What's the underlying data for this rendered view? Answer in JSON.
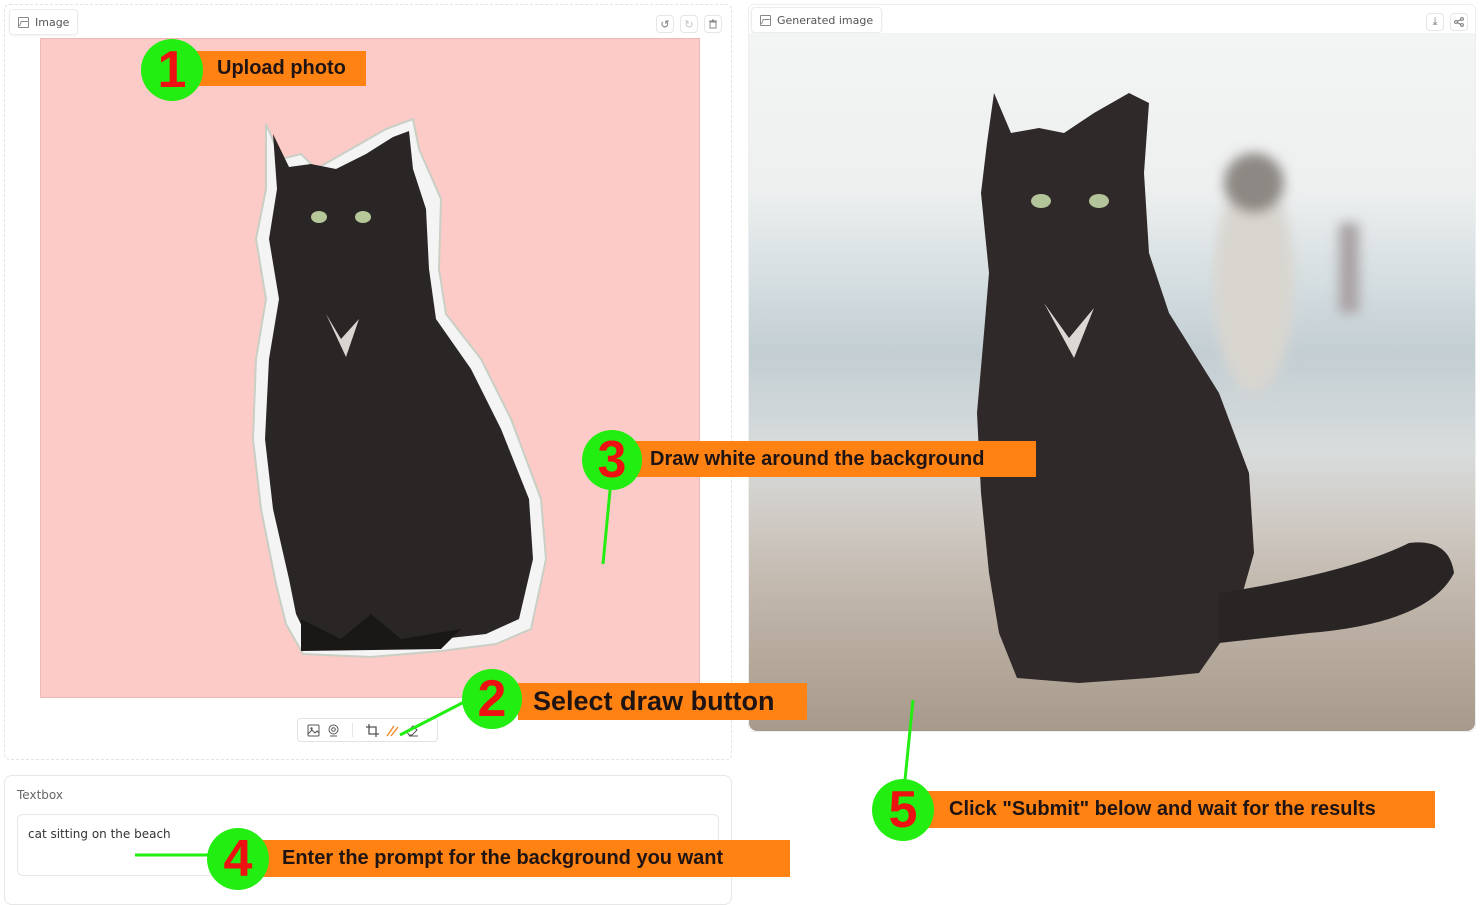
{
  "input_panel": {
    "label": "Image",
    "label_icon": "image-icon",
    "actions": [
      {
        "name": "undo-icon",
        "glyph": "↺"
      },
      {
        "name": "redo-icon",
        "glyph": "↻"
      },
      {
        "name": "trash-icon",
        "glyph": "🗑"
      }
    ],
    "canvas_background": "#fccbc8",
    "toolbar": [
      {
        "name": "upload-image-icon"
      },
      {
        "name": "webcam-icon"
      },
      {
        "name": "crop-icon"
      },
      {
        "name": "brush-icon",
        "active": true
      },
      {
        "name": "eraser-icon"
      }
    ]
  },
  "output_panel": {
    "label": "Generated image",
    "label_icon": "image-icon",
    "actions": [
      {
        "name": "download-icon",
        "glyph": "⤓"
      },
      {
        "name": "share-icon",
        "glyph": "⋖"
      }
    ]
  },
  "textbox": {
    "label": "Textbox",
    "value": "cat sitting on the beach"
  },
  "annotations": [
    {
      "step": "1",
      "text": "Upload photo"
    },
    {
      "step": "2",
      "text": "Select draw button"
    },
    {
      "step": "3",
      "text": "Draw white around the background"
    },
    {
      "step": "4",
      "text": "Enter the prompt for the background you want"
    },
    {
      "step": "5",
      "text": "Click \"Submit\" below and wait for the results"
    }
  ],
  "colors": {
    "bubble": "#22ee11",
    "number": "#ee1111",
    "banner": "#ff8212",
    "brush_active": "#f08a24"
  }
}
